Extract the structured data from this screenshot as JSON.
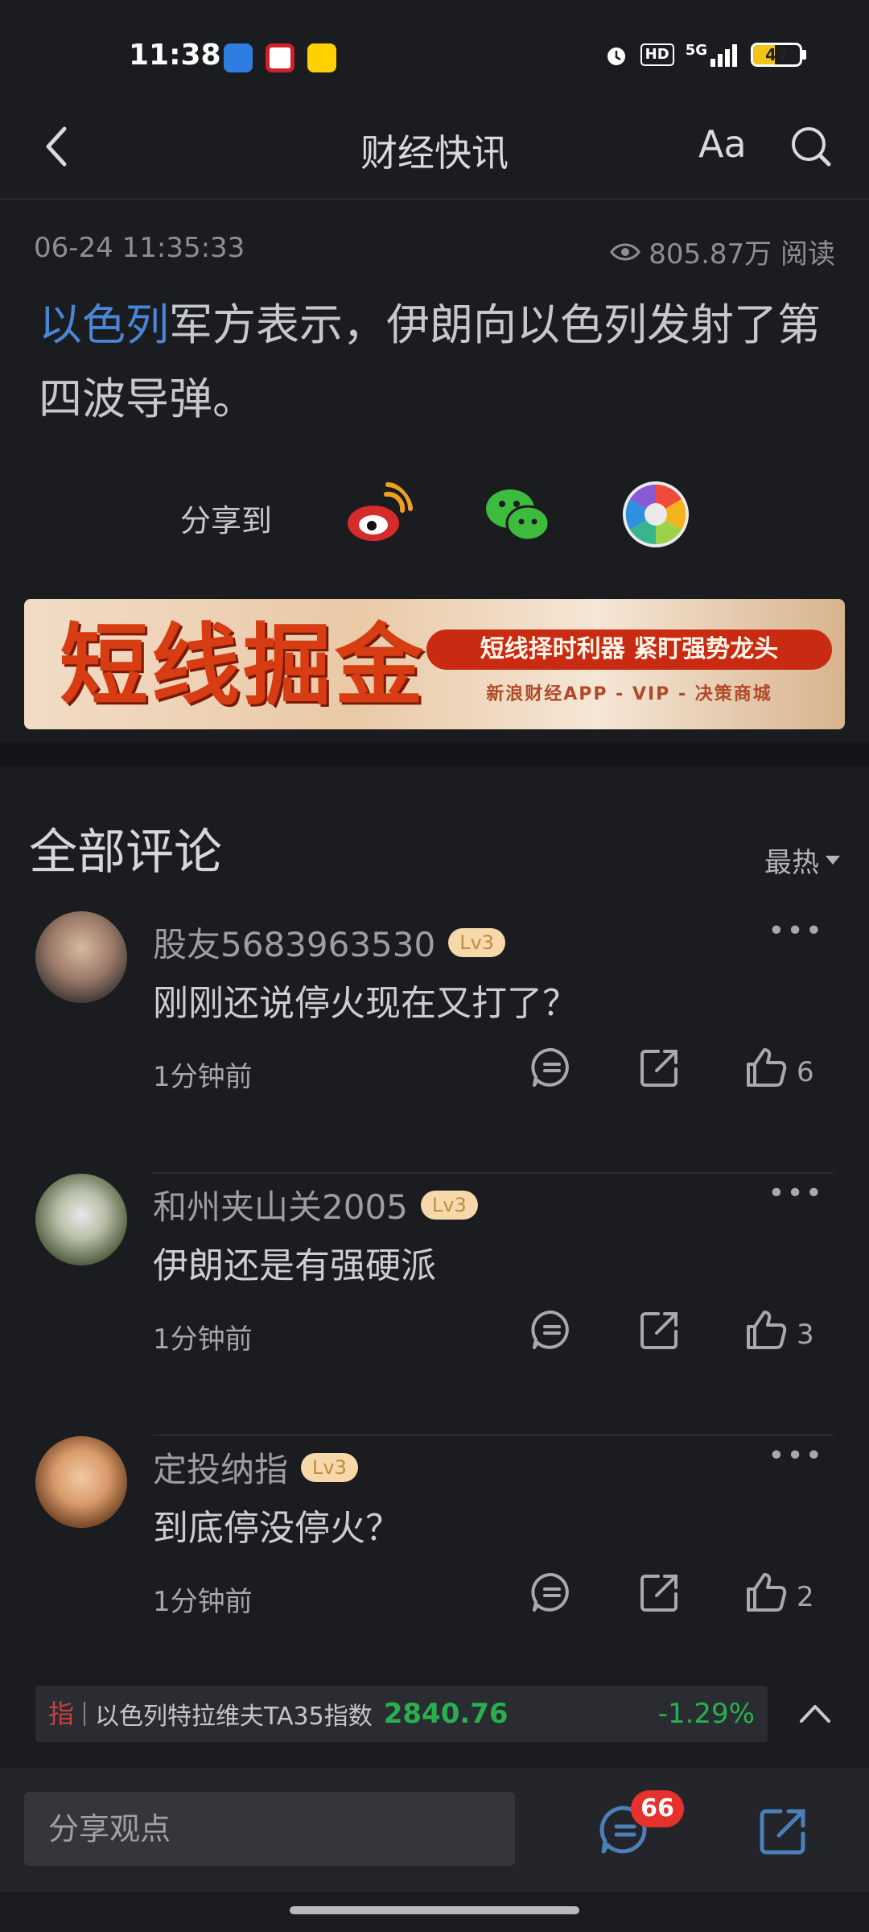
{
  "status_bar": {
    "time": "11:38",
    "network": "5G",
    "hd": "HD",
    "battery": "47"
  },
  "header": {
    "title": "财经快讯",
    "font_button": "Aa"
  },
  "article": {
    "timestamp": "06-24 11:35:33",
    "reads": "805.87万 阅读",
    "link_text": "以色列",
    "body_rest": "军方表示，伊朗向以色列发射了第四波导弹。",
    "share_label": "分享到"
  },
  "banner": {
    "headline": "短线掘金",
    "pill": "短线择时利器  紧盯强势龙头",
    "subline": "新浪财经APP - VIP - 决策商城"
  },
  "comments": {
    "title": "全部评论",
    "sort": "最热",
    "items": [
      {
        "user": "股友5683963530",
        "level": "Lv3",
        "text": "刚刚还说停火现在又打了？",
        "time": "1分钟前",
        "likes": "6"
      },
      {
        "user": "和州夹山关2005",
        "level": "Lv3",
        "text": "伊朗还是有强硬派",
        "time": "1分钟前",
        "likes": "3"
      },
      {
        "user": "定投纳指",
        "level": "Lv3",
        "text": "到底停没停火？",
        "time": "1分钟前",
        "likes": "2"
      }
    ]
  },
  "ticker": {
    "tag": "指",
    "name": "以色列特拉维夫TA35指数",
    "value": "2840.76",
    "change": "-1.29%",
    "color_down": "#27b04f"
  },
  "bottom_bar": {
    "input_placeholder": "分享观点",
    "comment_count": "66"
  },
  "colors": {
    "background": "#1b1c1f",
    "link": "#4a86d8",
    "badge": "#e6312c"
  }
}
